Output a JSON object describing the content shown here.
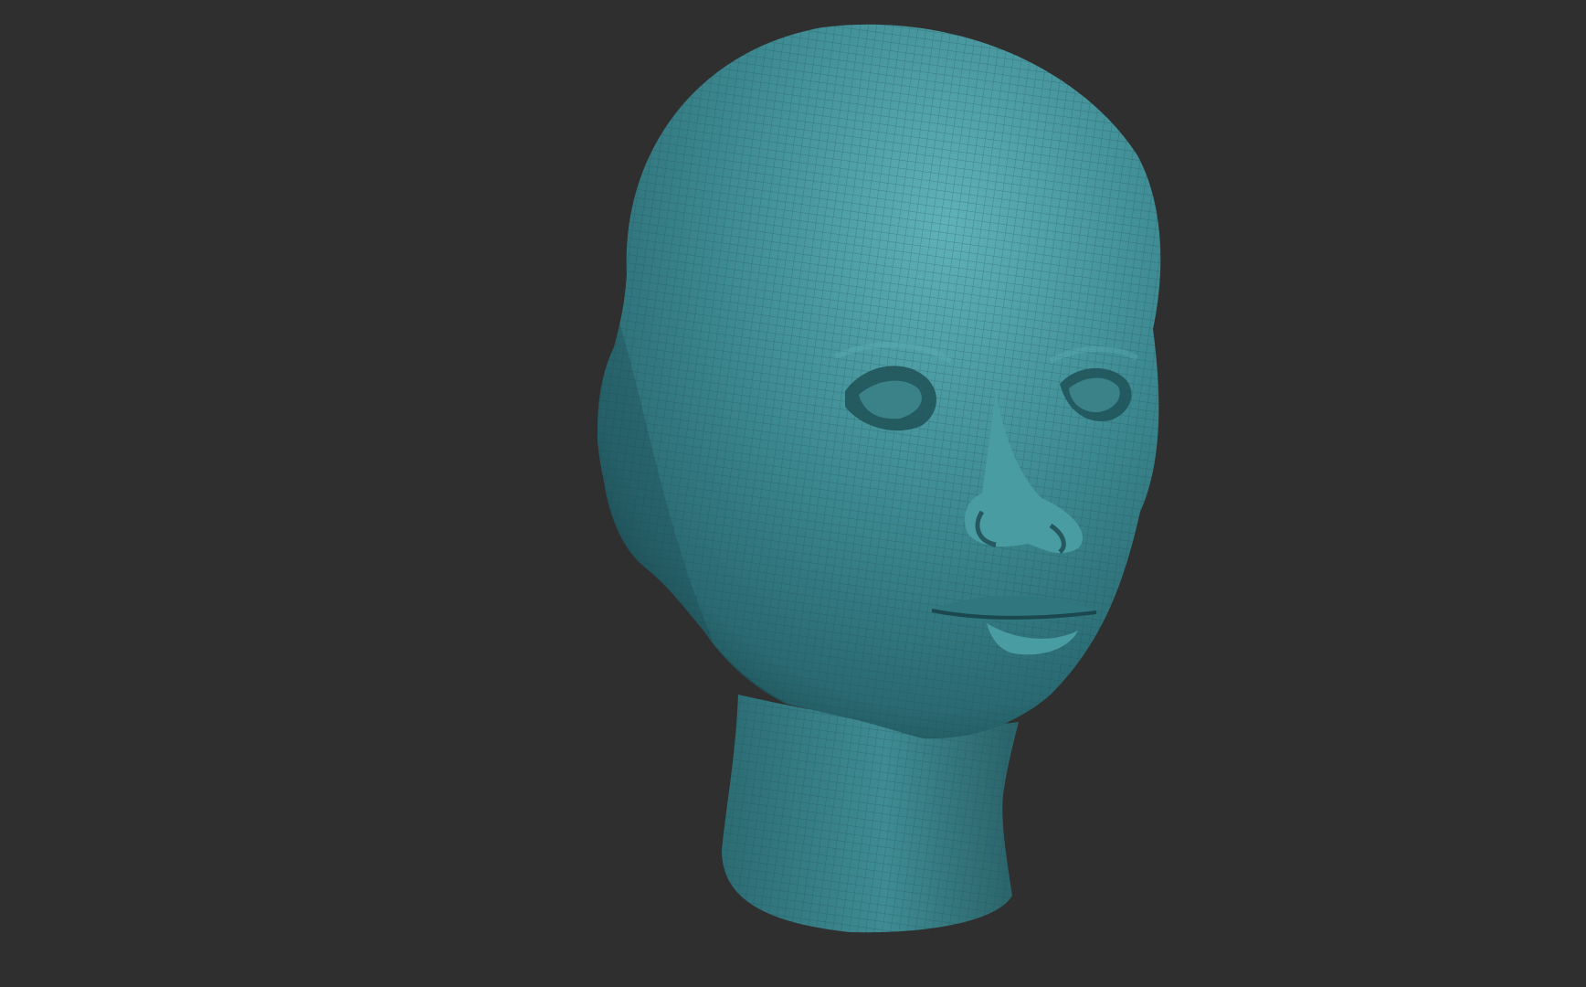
{
  "viewport": {
    "background": "#2f2f2f",
    "model": {
      "subject": "head-bust",
      "material_color": "#3f8c94",
      "highlight_color": "#5fb2b8",
      "shadow_color": "#163c42",
      "wireframe": true,
      "wire_color": "#1d4a50"
    }
  }
}
